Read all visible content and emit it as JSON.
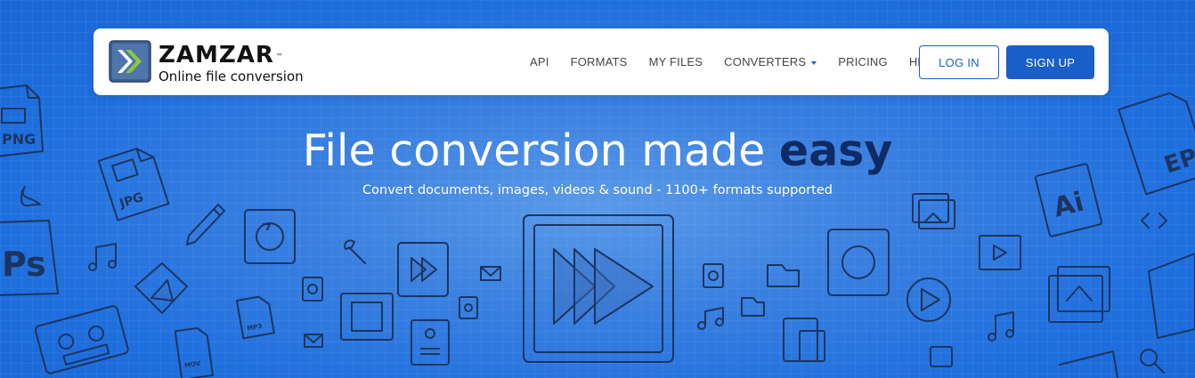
{
  "brand": {
    "name": "ZAMZAR",
    "trademark": "™",
    "tagline": "Online file conversion"
  },
  "nav": {
    "items": [
      {
        "label": "API"
      },
      {
        "label": "FORMATS"
      },
      {
        "label": "MY FILES"
      },
      {
        "label": "CONVERTERS",
        "has_dropdown": true
      },
      {
        "label": "PRICING"
      },
      {
        "label": "HELP"
      }
    ],
    "login_label": "LOG IN",
    "signup_label": "SIGN UP"
  },
  "hero": {
    "title_main": "File conversion made ",
    "title_emphasis": "easy",
    "subtitle": "Convert documents, images, videos & sound - 1100+ formats supported"
  },
  "background_icons": {
    "labels": [
      "PNG",
      "JPG",
      "Ps",
      "Ai",
      "EP",
      "MP3",
      "MOV"
    ]
  },
  "colors": {
    "background": "#1f6fde",
    "accent": "#1a5fc8",
    "emphasis": "#0f2b66",
    "logo_green": "#8dc63f"
  }
}
